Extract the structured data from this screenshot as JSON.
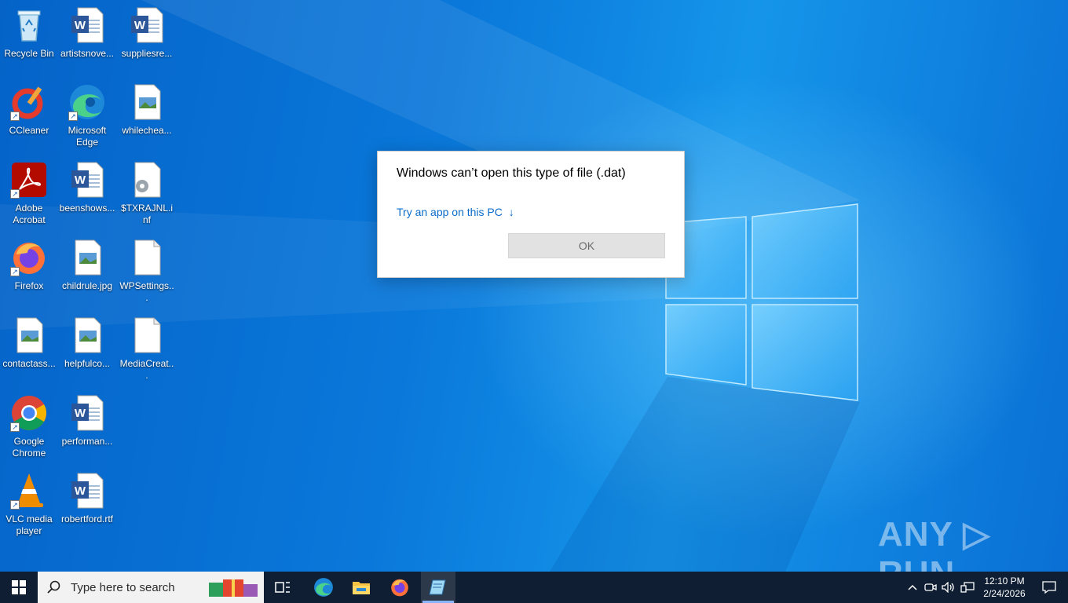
{
  "desktop": {
    "icons": [
      {
        "label": "Recycle Bin",
        "icon": "recycle-bin-icon"
      },
      {
        "label": "artistsnove...",
        "icon": "word-doc-icon"
      },
      {
        "label": "suppliesre...",
        "icon": "word-doc-icon"
      },
      {
        "label": "CCleaner",
        "icon": "ccleaner-icon"
      },
      {
        "label": "Microsoft Edge",
        "icon": "edge-icon"
      },
      {
        "label": "whilechea...",
        "icon": "image-file-icon"
      },
      {
        "label": "Adobe Acrobat",
        "icon": "acrobat-icon"
      },
      {
        "label": "beenshows...",
        "icon": "word-doc-icon"
      },
      {
        "label": "$TXRAJNL.inf",
        "icon": "settings-file-icon"
      },
      {
        "label": "Firefox",
        "icon": "firefox-icon"
      },
      {
        "label": "childrule.jpg",
        "icon": "image-file-icon"
      },
      {
        "label": "WPSettings...",
        "icon": "blank-file-icon"
      },
      {
        "label": "contactass...",
        "icon": "image-file-icon"
      },
      {
        "label": "helpfulco...",
        "icon": "image-file-icon"
      },
      {
        "label": "MediaCreat...",
        "icon": "blank-file-icon"
      },
      {
        "label": "Google Chrome",
        "icon": "chrome-icon"
      },
      {
        "label": "performan...",
        "icon": "word-doc-icon"
      },
      {
        "label": "VLC media player",
        "icon": "vlc-icon"
      },
      {
        "label": "robertford.rtf",
        "icon": "word-doc-icon"
      }
    ]
  },
  "dialog": {
    "title": "Windows can’t open this type of file (.dat)",
    "link": "Try an app on this PC",
    "link_arrow": "↓",
    "ok_label": "OK"
  },
  "watermark": {
    "text": "ANY ▷ RUN"
  },
  "taskbar": {
    "search_placeholder": "Type here to search",
    "time": "12:10 PM",
    "date": "2/24/2026"
  },
  "colors": {
    "taskbar_bg": "#0f1e33",
    "desktop_blue": "#0078d7",
    "link_blue": "#0a6cc8"
  }
}
